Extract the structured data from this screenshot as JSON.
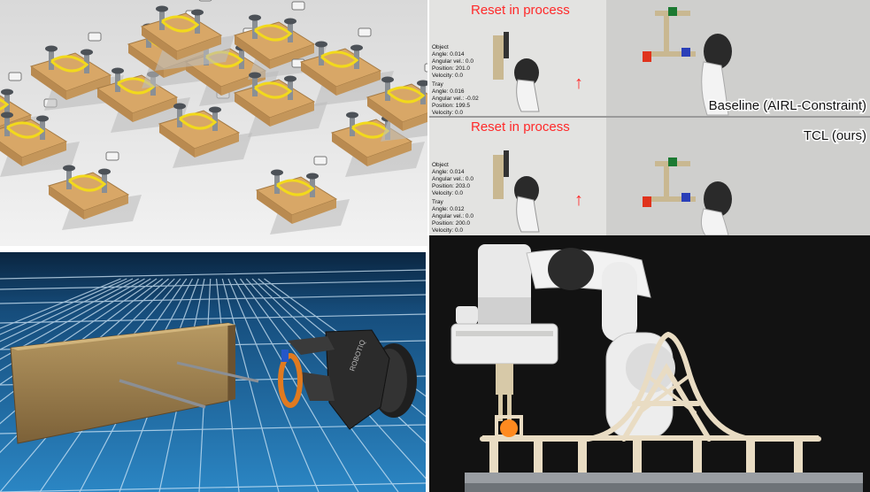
{
  "video_panel": {
    "top_view": {
      "banner": "Reset in process",
      "object_header": "Object",
      "object_lines": [
        "Angle: 0.014",
        "Angular vel.: 0.0",
        "Position: 201.0",
        "Velocity: 0.0"
      ],
      "tray_header": "Tray",
      "tray_lines": [
        "Angle: 0.016",
        "Angular vel.: -0.02",
        "Position: 199.5",
        "Velocity: 0.0"
      ],
      "method_label": "Baseline (AIRL-Constraint)"
    },
    "bottom_view": {
      "banner": "Reset in process",
      "object_header": "Object",
      "object_lines": [
        "Angle: 0.014",
        "Angular vel.: 0.0",
        "Position: 203.0",
        "Velocity: 0.0"
      ],
      "tray_header": "Tray",
      "tray_lines": [
        "Angle: 0.012",
        "Angular vel.: 0.0",
        "Position: 200.0",
        "Velocity: 0.0"
      ],
      "method_label": "TCL (ours)"
    },
    "arrow_glyph": "↑"
  },
  "gripper_logo": "ROBOTIQ",
  "colors": {
    "banner_red": "#ff2a2a",
    "rope_yellow": "#f2d91c",
    "wood": "#d8a767",
    "grid_blue": "#1d6aa5",
    "rail_cream": "#e9dcc3",
    "ball_orange": "#ff8a1f"
  }
}
